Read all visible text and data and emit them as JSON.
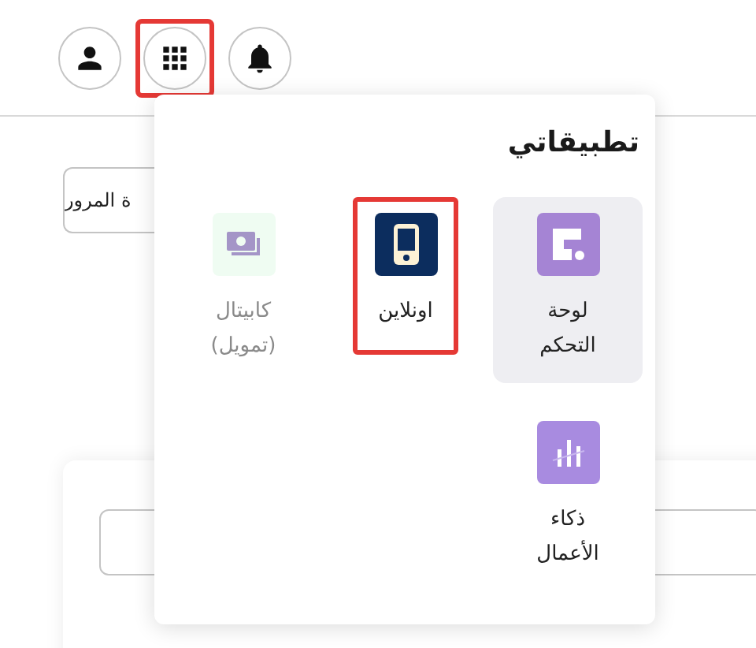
{
  "header": {
    "buttons": [
      {
        "kind": "profile",
        "highlighted": false
      },
      {
        "kind": "apps",
        "highlighted": true
      },
      {
        "kind": "notifications",
        "highlighted": false
      }
    ]
  },
  "background": {
    "field_text": "ة المرور"
  },
  "apps_menu": {
    "title": "تطبيقاتي",
    "apps": [
      {
        "kind": "dashboard",
        "label": "لوحة التحكم",
        "hovered": true,
        "highlighted": false,
        "disabled": false
      },
      {
        "kind": "online",
        "label": "اونلاين",
        "hovered": false,
        "highlighted": true,
        "disabled": false
      },
      {
        "kind": "capital",
        "label": "كابيتال (تمويل)",
        "hovered": false,
        "highlighted": false,
        "disabled": true
      },
      {
        "kind": "analytics",
        "label": "ذكاء الأعمال",
        "hovered": false,
        "highlighted": false,
        "disabled": false
      }
    ]
  }
}
